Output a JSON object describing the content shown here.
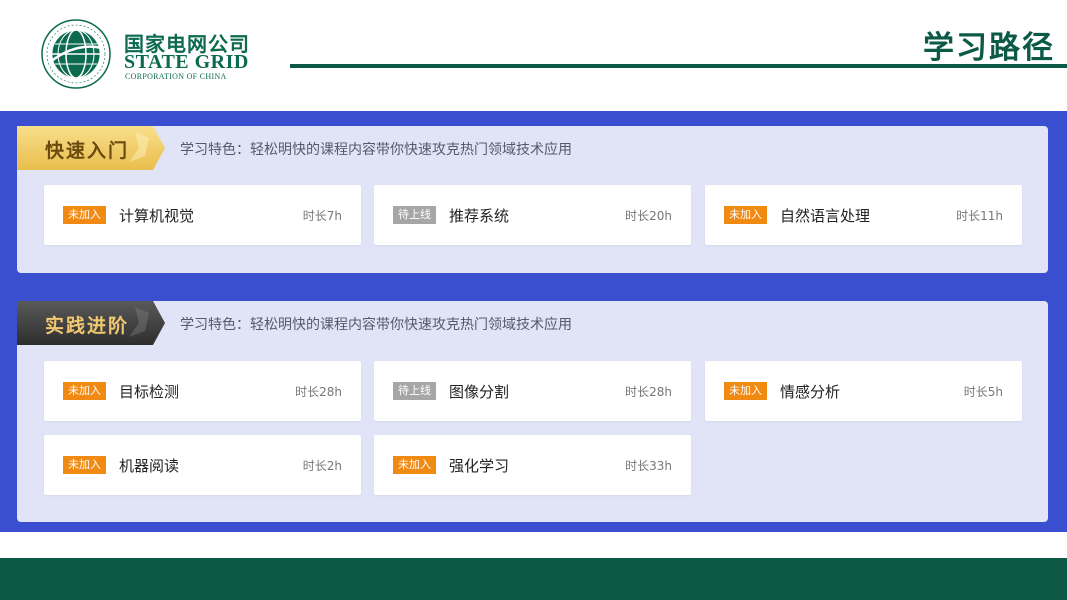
{
  "header": {
    "logo_cn": "国家电网公司",
    "logo_en": "STATE GRID",
    "logo_en_sub": "CORPORATION OF CHINA",
    "title": "学习路径"
  },
  "colors": {
    "brand_green": "#0c5a46",
    "band_blue": "#3a4fcf",
    "panel_bg": "#e1e4f7",
    "badge_orange": "#f08a12",
    "badge_gray": "#a6a6a6"
  },
  "sections": [
    {
      "tag": "快速入门",
      "feature": "学习特色：轻松明快的课程内容带你快速攻克热门领域技术应用",
      "courses": [
        {
          "badge": "未加入",
          "name": "计算机视觉",
          "duration": "时长7h"
        },
        {
          "badge": "待上线",
          "name": "推荐系统",
          "duration": "时长20h"
        },
        {
          "badge": "未加入",
          "name": "自然语言处理",
          "duration": "时长11h"
        }
      ]
    },
    {
      "tag": "实践进阶",
      "feature": "学习特色：轻松明快的课程内容带你快速攻克热门领域技术应用",
      "courses": [
        {
          "badge": "未加入",
          "name": "目标检测",
          "duration": "时长28h"
        },
        {
          "badge": "待上线",
          "name": "图像分割",
          "duration": "时长28h"
        },
        {
          "badge": "未加入",
          "name": "情感分析",
          "duration": "时长5h"
        },
        {
          "badge": "未加入",
          "name": "机器阅读",
          "duration": "时长2h"
        },
        {
          "badge": "未加入",
          "name": "强化学习",
          "duration": "时长33h"
        }
      ]
    }
  ]
}
